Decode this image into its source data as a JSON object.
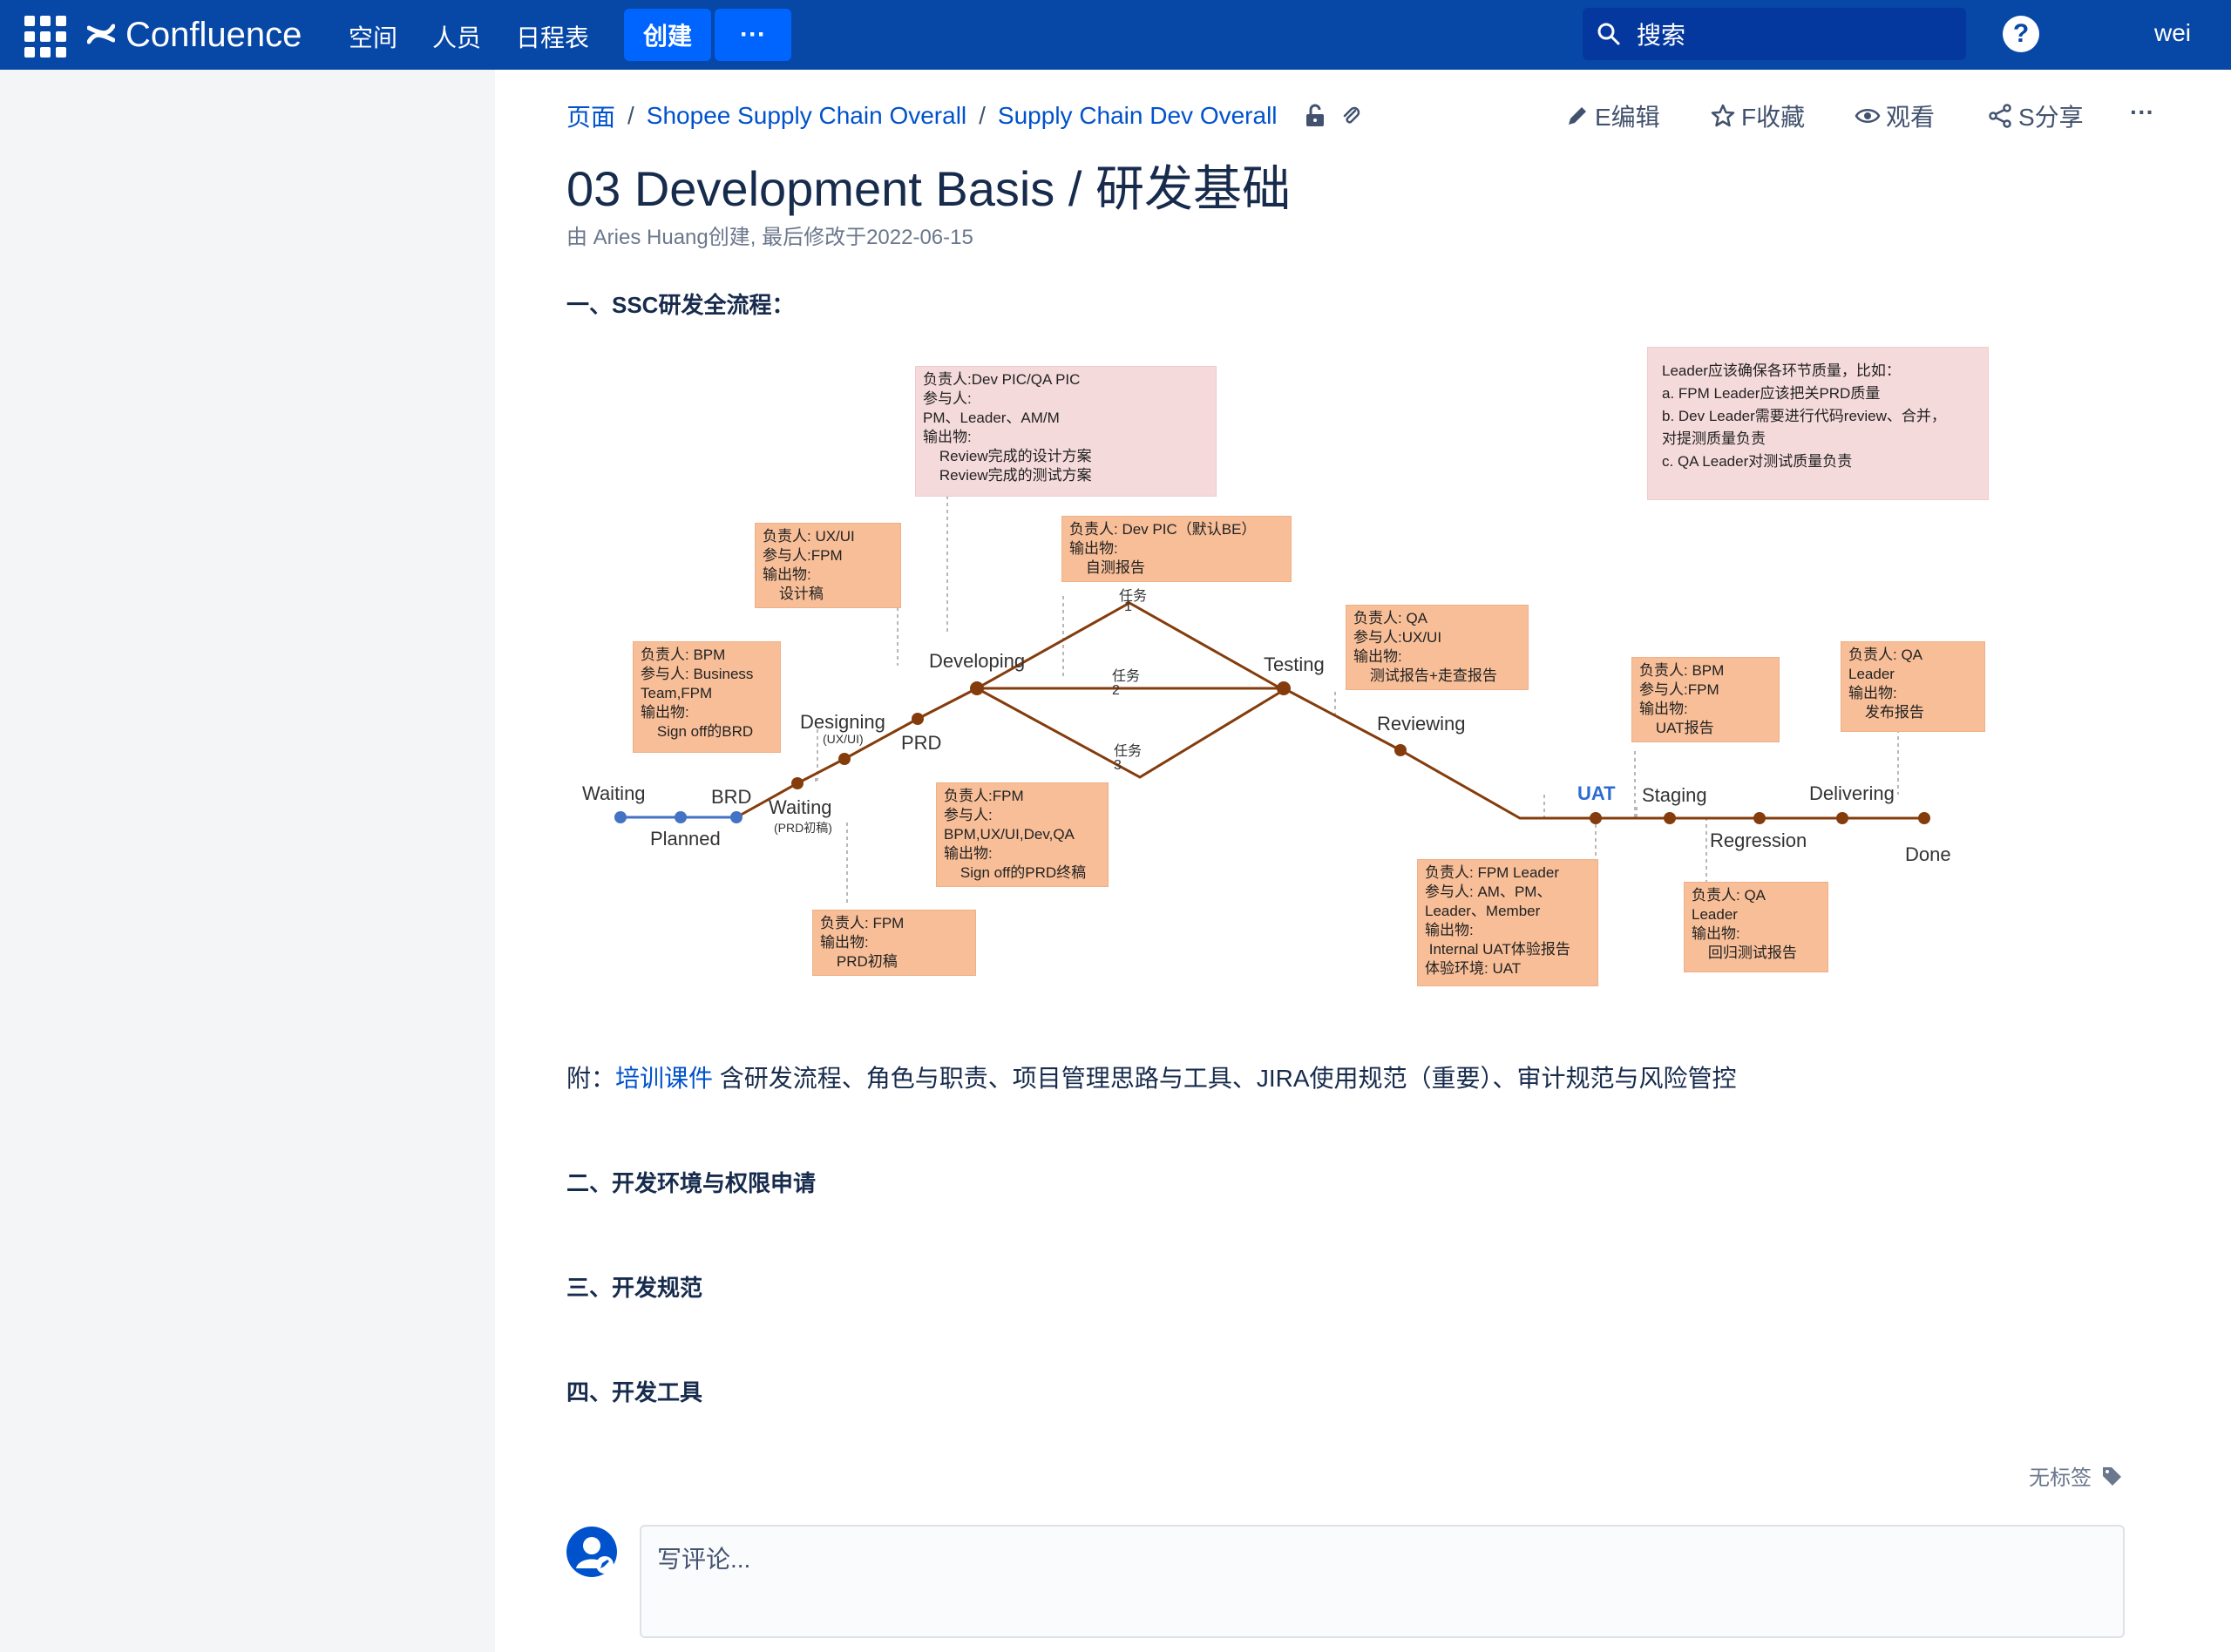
{
  "nav": {
    "product": "Confluence",
    "items": [
      "空间",
      "人员",
      "日程表"
    ],
    "create": "创建",
    "more": "···",
    "search_placeholder": "搜索",
    "help": "?",
    "user": "wei"
  },
  "breadcrumb": [
    "页面",
    "Shopee Supply Chain Overall",
    "Supply Chain Dev Overall"
  ],
  "actions": [
    {
      "icon": "pencil-icon",
      "label": "E编辑"
    },
    {
      "icon": "star-icon",
      "label": "F收藏"
    },
    {
      "icon": "eye-icon",
      "label": "观看"
    },
    {
      "icon": "share-icon",
      "label": "S分享"
    },
    {
      "icon": "more-icon",
      "label": "···"
    }
  ],
  "page": {
    "title": "03 Development Basis / 研发基础",
    "byline": "由 Aries Huang创建, 最后修改于2022-06-15"
  },
  "sections": {
    "s1": "一、SSC研发全流程：",
    "s2": "二、开发环境与权限申请",
    "s3": "三、开发规范",
    "s4": "四、开发工具"
  },
  "diagram": {
    "boxes": {
      "leader": "Leader应该确保各环节质量，比如：\na. FPM Leader应该把关PRD质量\nb. Dev Leader需要进行代码review、合并，\n对提测质量负责\nc. QA Leader对测试质量负责",
      "developing": "负责人:Dev PIC/QA PIC\n参与人:\nPM、Leader、AM/M\n输出物:\n    Review完成的设计方案\n    Review完成的测试方案",
      "design": "负责人: UX/UI\n参与人:FPM\n输出物:\n    设计稿",
      "self_test": "负责人: Dev PIC（默认BE）\n输出物:\n    自测报告",
      "testing": "负责人: QA\n参与人:UX/UI\n输出物:\n    测试报告+走查报告",
      "brd": "负责人: BPM\n参与人: Business\nTeam,FPM\n输出物:\n    Sign off的BRD",
      "prd_final": "负责人:FPM\n参与人:\nBPM,UX/UI,Dev,QA\n输出物:\n    Sign off的PRD终稿",
      "prd_draft": "负责人: FPM\n输出物:\n    PRD初稿",
      "uat_report": "负责人: BPM\n参与人:FPM\n输出物:\n    UAT报告",
      "release": "负责人: QA\nLeader\n输出物:\n    发布报告",
      "uat": "负责人: FPM Leader\n参与人: AM、PM、\nLeader、Member\n输出物:\n Internal UAT体验报告\n体验环境: UAT",
      "regression": "负责人: QA\nLeader\n输出物:\n    回归测试报告"
    },
    "stages": {
      "waiting": "Waiting",
      "brd": "BRD",
      "planned": "Planned",
      "waiting2": "Waiting",
      "waiting2_sub": "(PRD初稿)",
      "designing": "Designing",
      "designing_sub": "(UX/UI)",
      "prd": "PRD",
      "developing": "Developing",
      "task1": "任务",
      "task1_n": "1",
      "task2": "任务",
      "task2_n": "2",
      "task3": "任务",
      "task3_n": "3",
      "testing": "Testing",
      "reviewing": "Reviewing",
      "uat": "UAT",
      "staging": "Staging",
      "regression": "Regression",
      "delivering": "Delivering",
      "done": "Done"
    }
  },
  "appendix": {
    "prefix": "附：",
    "link": "培训课件",
    "suffix": " 含研发流程、角色与职责、项目管理思路与工具、JIRA使用规范（重要）、审计规范与风险管控"
  },
  "labels": "无标签",
  "comment_placeholder": "写评论..."
}
